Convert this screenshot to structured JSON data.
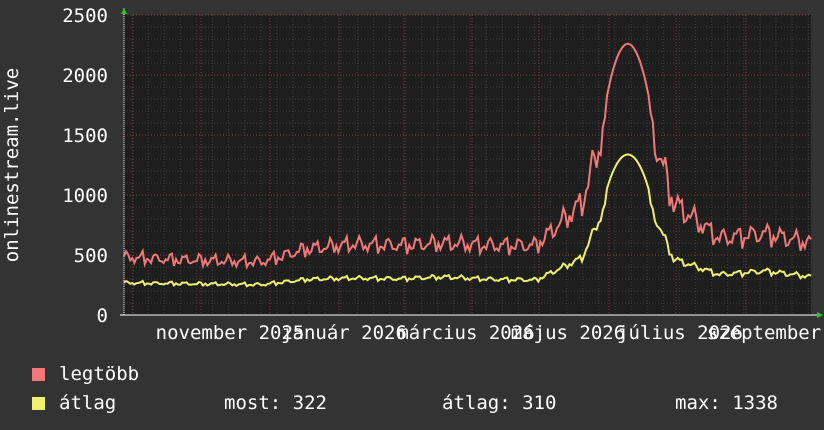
{
  "colors": {
    "background": "#333333",
    "plot_background": "#1e1e1e",
    "grid_minor": "#3c3c3c",
    "grid_major": "#7a3a3a",
    "axis": "#ffffff",
    "arrow": "#22cc22",
    "max_series": "#f07878",
    "avg_series": "#f0f070"
  },
  "legend": {
    "max_label": "legtöbb",
    "avg_label": "átlag",
    "now": "most: 322",
    "average": "átlag: 310",
    "max": "max: 1338"
  },
  "chart_data": {
    "type": "line",
    "ylabel": "onlinestream.live",
    "ylim": [
      0,
      2500
    ],
    "yticks": [
      0,
      500,
      1000,
      1500,
      2000,
      2500
    ],
    "x_tick_labels": [
      "november 2025",
      "január 2026",
      "március 2026",
      "május 2026",
      "július 2026",
      "szeptember"
    ],
    "grid": true,
    "x": [
      "2025-10",
      "2025-11",
      "2025-12",
      "2026-01",
      "2026-02",
      "2026-03",
      "2026-04",
      "2026-05",
      "2026-06",
      "2026-07",
      "2026-07-20",
      "2026-07-25",
      "2026-08",
      "2026-08-15",
      "2026-08-25",
      "2026-09"
    ],
    "series": [
      {
        "name": "legtöbb",
        "values": [
          490,
          470,
          460,
          450,
          560,
          600,
          590,
          610,
          590,
          590,
          950,
          2260,
          950,
          650,
          690,
          610
        ]
      },
      {
        "name": "átlag",
        "values": [
          270,
          265,
          260,
          255,
          300,
          310,
          305,
          320,
          300,
          295,
          480,
          1338,
          470,
          340,
          370,
          322
        ]
      }
    ]
  }
}
